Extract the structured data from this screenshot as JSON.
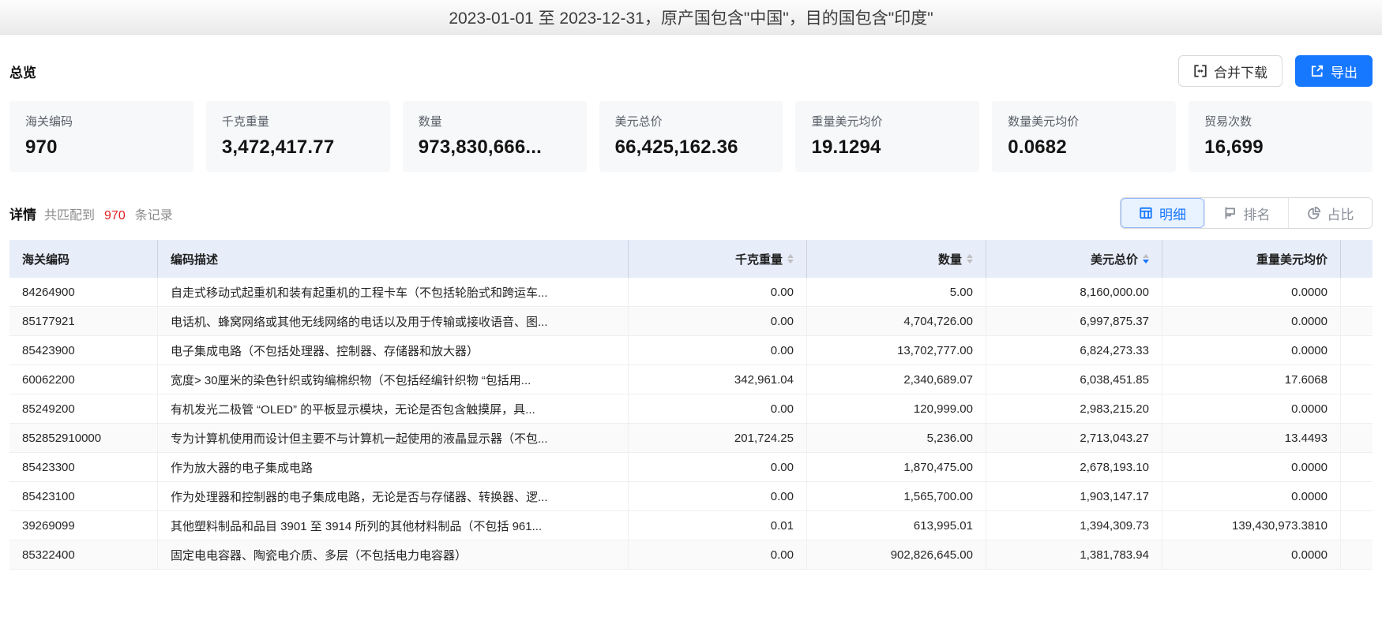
{
  "header": {
    "title": "2023-01-01 至 2023-12-31，原产国包含\"中国\"，目的国包含\"印度\""
  },
  "overview": {
    "title": "总览",
    "merge_download_label": "合并下载",
    "export_label": "导出",
    "cards": [
      {
        "label": "海关编码",
        "value": "970"
      },
      {
        "label": "千克重量",
        "value": "3,472,417.77"
      },
      {
        "label": "数量",
        "value": "973,830,666..."
      },
      {
        "label": "美元总价",
        "value": "66,425,162.36"
      },
      {
        "label": "重量美元均价",
        "value": "19.1294"
      },
      {
        "label": "数量美元均价",
        "value": "0.0682"
      },
      {
        "label": "贸易次数",
        "value": "16,699"
      }
    ]
  },
  "details": {
    "title": "详情",
    "match_prefix": "共匹配到",
    "match_count": "970",
    "match_suffix": "条记录",
    "tabs": [
      {
        "label": "明细",
        "icon": "table-icon",
        "active": true
      },
      {
        "label": "排名",
        "icon": "flag-icon",
        "active": false
      },
      {
        "label": "占比",
        "icon": "pie-icon",
        "active": false
      }
    ]
  },
  "table": {
    "columns": [
      {
        "label": "海关编码",
        "align": "left",
        "sort": null
      },
      {
        "label": "编码描述",
        "align": "left",
        "sort": null
      },
      {
        "label": "千克重量",
        "align": "right",
        "sort": "none"
      },
      {
        "label": "数量",
        "align": "right",
        "sort": "none"
      },
      {
        "label": "美元总价",
        "align": "right",
        "sort": "desc"
      },
      {
        "label": "重量美元均价",
        "align": "right",
        "sort": null
      },
      {
        "label": "",
        "align": "left",
        "sort": null
      }
    ],
    "rows": [
      {
        "code": "84264900",
        "desc": "自走式移动式起重机和装有起重机的工程卡车（不包括轮胎式和跨运车...",
        "weight": "0.00",
        "qty": "5.00",
        "total": "8,160,000.00",
        "avg": "0.0000"
      },
      {
        "code": "85177921",
        "desc": "电话机、蜂窝网络或其他无线网络的电话以及用于传输或接收语音、图...",
        "weight": "0.00",
        "qty": "4,704,726.00",
        "total": "6,997,875.37",
        "avg": "0.0000"
      },
      {
        "code": "85423900",
        "desc": "电子集成电路（不包括处理器、控制器、存储器和放大器）",
        "weight": "0.00",
        "qty": "13,702,777.00",
        "total": "6,824,273.33",
        "avg": "0.0000"
      },
      {
        "code": "60062200",
        "desc": "宽度> 30厘米的染色针织或钩编棉织物（不包括经编针织物 “包括用...",
        "weight": "342,961.04",
        "qty": "2,340,689.07",
        "total": "6,038,451.85",
        "avg": "17.6068"
      },
      {
        "code": "85249200",
        "desc": "有机发光二极管 “OLED” 的平板显示模块，无论是否包含触摸屏，具...",
        "weight": "0.00",
        "qty": "120,999.00",
        "total": "2,983,215.20",
        "avg": "0.0000"
      },
      {
        "code": "852852910000",
        "desc": "专为计算机使用而设计但主要不与计算机一起使用的液晶显示器（不包...",
        "weight": "201,724.25",
        "qty": "5,236.00",
        "total": "2,713,043.27",
        "avg": "13.4493"
      },
      {
        "code": "85423300",
        "desc": "作为放大器的电子集成电路",
        "weight": "0.00",
        "qty": "1,870,475.00",
        "total": "2,678,193.10",
        "avg": "0.0000"
      },
      {
        "code": "85423100",
        "desc": "作为处理器和控制器的电子集成电路，无论是否与存储器、转换器、逻...",
        "weight": "0.00",
        "qty": "1,565,700.00",
        "total": "1,903,147.17",
        "avg": "0.0000"
      },
      {
        "code": "39269099",
        "desc": "其他塑料制品和品目 3901 至 3914 所列的其他材料制品（不包括 961...",
        "weight": "0.01",
        "qty": "613,995.01",
        "total": "1,394,309.73",
        "avg": "139,430,973.3810"
      },
      {
        "code": "85322400",
        "desc": "固定电电容器、陶瓷电介质、多层（不包括电力电容器）",
        "weight": "0.00",
        "qty": "902,826,645.00",
        "total": "1,381,783.94",
        "avg": "0.0000"
      }
    ]
  },
  "colors": {
    "accent_blue": "#1677ff",
    "count_red": "#e02020",
    "table_header_bg": "#e8edfa",
    "card_bg": "#f7f8fa"
  }
}
